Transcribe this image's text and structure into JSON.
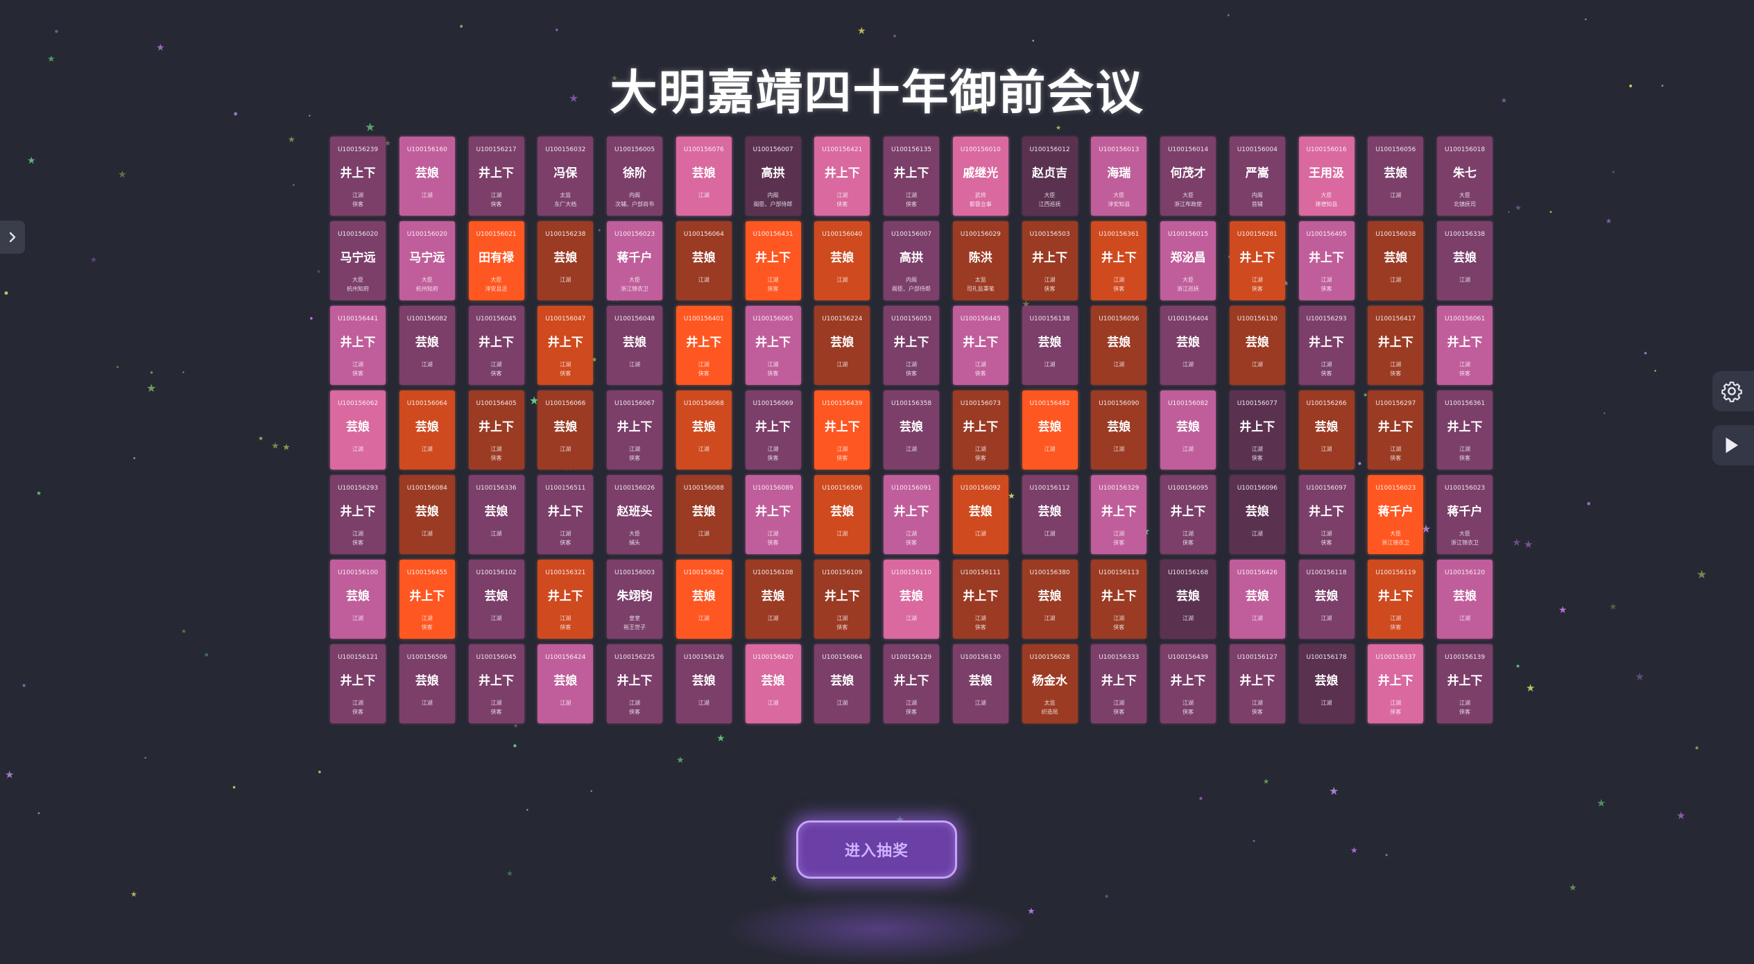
{
  "page": {
    "title": "大明嘉靖四十年御前会议",
    "enter_button_label": "进入抽奖",
    "left_tab_icon": "chevron-right-icon",
    "right_buttons": [
      {
        "icon": "gear-icon"
      },
      {
        "icon": "play-icon"
      }
    ]
  },
  "colors": {
    "background": "#262833",
    "card_palette": [
      "#c05e9b",
      "#7b3f6a",
      "#cf4a1f",
      "#9b3b24",
      "#ff5721",
      "#5a3250",
      "#d9699f"
    ],
    "button_border": "#c6a2ff",
    "button_fill": "#6a3fa6",
    "button_text": "#cfb3ff"
  },
  "cards": [
    {
      "id": "U100156239",
      "name": "井上下",
      "line1": "江湖",
      "line2": "侠客",
      "color": 1
    },
    {
      "id": "U100156160",
      "name": "芸娘",
      "line1": "江湖",
      "line2": "",
      "color": 0
    },
    {
      "id": "U100156217",
      "name": "井上下",
      "line1": "江湖",
      "line2": "侠客",
      "color": 1
    },
    {
      "id": "U100156032",
      "name": "冯保",
      "line1": "太监",
      "line2": "东厂大档",
      "color": 1
    },
    {
      "id": "U100156005",
      "name": "徐阶",
      "line1": "内阁",
      "line2": "次辅、户部尚书",
      "color": 1
    },
    {
      "id": "U100156076",
      "name": "芸娘",
      "line1": "江湖",
      "line2": "",
      "color": 6
    },
    {
      "id": "U100156007",
      "name": "高拱",
      "line1": "内阁",
      "line2": "阁臣、户部侍郎",
      "color": 5
    },
    {
      "id": "U100156421",
      "name": "井上下",
      "line1": "江湖",
      "line2": "侠客",
      "color": 6
    },
    {
      "id": "U100156135",
      "name": "井上下",
      "line1": "江湖",
      "line2": "侠客",
      "color": 1
    },
    {
      "id": "U100156010",
      "name": "戚继光",
      "line1": "武将",
      "line2": "都督佥事",
      "color": 6
    },
    {
      "id": "U100156012",
      "name": "赵贞吉",
      "line1": "大臣",
      "line2": "江西巡抚",
      "color": 5
    },
    {
      "id": "U100156013",
      "name": "海瑞",
      "line1": "大臣",
      "line2": "淳安知县",
      "color": 0
    },
    {
      "id": "U100156014",
      "name": "何茂才",
      "line1": "大臣",
      "line2": "浙江布政使",
      "color": 1
    },
    {
      "id": "U100156004",
      "name": "严嵩",
      "line1": "内阁",
      "line2": "首辅",
      "color": 1
    },
    {
      "id": "U100156016",
      "name": "王用汲",
      "line1": "大臣",
      "line2": "建德知县",
      "color": 6
    },
    {
      "id": "U100156056",
      "name": "芸娘",
      "line1": "江湖",
      "line2": "",
      "color": 1
    },
    {
      "id": "U100156018",
      "name": "朱七",
      "line1": "大臣",
      "line2": "北镇抚司",
      "color": 1
    },
    {
      "id": "U100156020",
      "name": "马宁远",
      "line1": "大臣",
      "line2": "杭州知府",
      "color": 1
    },
    {
      "id": "U100156020",
      "name": "马宁远",
      "line1": "大臣",
      "line2": "杭州知府",
      "color": 0
    },
    {
      "id": "U100156021",
      "name": "田有禄",
      "line1": "大臣",
      "line2": "淳安县丞",
      "color": 4
    },
    {
      "id": "U100156238",
      "name": "芸娘",
      "line1": "江湖",
      "line2": "",
      "color": 3
    },
    {
      "id": "U100156023",
      "name": "蒋千户",
      "line1": "大臣",
      "line2": "浙江锦衣卫",
      "color": 0
    },
    {
      "id": "U100156064",
      "name": "芸娘",
      "line1": "江湖",
      "line2": "",
      "color": 3
    },
    {
      "id": "U100156431",
      "name": "井上下",
      "line1": "江湖",
      "line2": "侠客",
      "color": 4
    },
    {
      "id": "U100156040",
      "name": "芸娘",
      "line1": "江湖",
      "line2": "",
      "color": 2
    },
    {
      "id": "U100156007",
      "name": "高拱",
      "line1": "内阁",
      "line2": "阁臣、户部侍郎",
      "color": 1
    },
    {
      "id": "U100156029",
      "name": "陈洪",
      "line1": "太监",
      "line2": "司礼监秉笔",
      "color": 3
    },
    {
      "id": "U100156503",
      "name": "井上下",
      "line1": "江湖",
      "line2": "侠客",
      "color": 3
    },
    {
      "id": "U100156361",
      "name": "井上下",
      "line1": "江湖",
      "line2": "侠客",
      "color": 2
    },
    {
      "id": "U100156015",
      "name": "郑泌昌",
      "line1": "大臣",
      "line2": "浙江巡抚",
      "color": 0
    },
    {
      "id": "U100156281",
      "name": "井上下",
      "line1": "江湖",
      "line2": "侠客",
      "color": 2
    },
    {
      "id": "U100156405",
      "name": "井上下",
      "line1": "江湖",
      "line2": "侠客",
      "color": 0
    },
    {
      "id": "U100156038",
      "name": "芸娘",
      "line1": "江湖",
      "line2": "",
      "color": 3
    },
    {
      "id": "U100156338",
      "name": "芸娘",
      "line1": "江湖",
      "line2": "",
      "color": 1
    },
    {
      "id": "U100156441",
      "name": "井上下",
      "line1": "江湖",
      "line2": "侠客",
      "color": 0
    },
    {
      "id": "U100156082",
      "name": "芸娘",
      "line1": "江湖",
      "line2": "",
      "color": 1
    },
    {
      "id": "U100156045",
      "name": "井上下",
      "line1": "江湖",
      "line2": "侠客",
      "color": 1
    },
    {
      "id": "U100156047",
      "name": "井上下",
      "line1": "江湖",
      "line2": "侠客",
      "color": 2
    },
    {
      "id": "U100156048",
      "name": "芸娘",
      "line1": "江湖",
      "line2": "",
      "color": 1
    },
    {
      "id": "U100156401",
      "name": "井上下",
      "line1": "江湖",
      "line2": "侠客",
      "color": 4
    },
    {
      "id": "U100156065",
      "name": "井上下",
      "line1": "江湖",
      "line2": "侠客",
      "color": 0
    },
    {
      "id": "U100156224",
      "name": "芸娘",
      "line1": "江湖",
      "line2": "",
      "color": 3
    },
    {
      "id": "U100156053",
      "name": "井上下",
      "line1": "江湖",
      "line2": "侠客",
      "color": 1
    },
    {
      "id": "U100156445",
      "name": "井上下",
      "line1": "江湖",
      "line2": "侠客",
      "color": 0
    },
    {
      "id": "U100156138",
      "name": "芸娘",
      "line1": "江湖",
      "line2": "",
      "color": 1
    },
    {
      "id": "U100156056",
      "name": "芸娘",
      "line1": "江湖",
      "line2": "",
      "color": 3
    },
    {
      "id": "U100156404",
      "name": "芸娘",
      "line1": "江湖",
      "line2": "",
      "color": 1
    },
    {
      "id": "U100156130",
      "name": "芸娘",
      "line1": "江湖",
      "line2": "",
      "color": 3
    },
    {
      "id": "U100156293",
      "name": "井上下",
      "line1": "江湖",
      "line2": "侠客",
      "color": 1
    },
    {
      "id": "U100156417",
      "name": "井上下",
      "line1": "江湖",
      "line2": "侠客",
      "color": 3
    },
    {
      "id": "U100156061",
      "name": "井上下",
      "line1": "江湖",
      "line2": "侠客",
      "color": 0
    },
    {
      "id": "U100156062",
      "name": "芸娘",
      "line1": "江湖",
      "line2": "",
      "color": 6
    },
    {
      "id": "U100156064",
      "name": "芸娘",
      "line1": "江湖",
      "line2": "",
      "color": 2
    },
    {
      "id": "U100156405",
      "name": "井上下",
      "line1": "江湖",
      "line2": "侠客",
      "color": 3
    },
    {
      "id": "U100156066",
      "name": "芸娘",
      "line1": "江湖",
      "line2": "",
      "color": 3
    },
    {
      "id": "U100156067",
      "name": "井上下",
      "line1": "江湖",
      "line2": "侠客",
      "color": 1
    },
    {
      "id": "U100156068",
      "name": "芸娘",
      "line1": "江湖",
      "line2": "",
      "color": 2
    },
    {
      "id": "U100156069",
      "name": "井上下",
      "line1": "江湖",
      "line2": "侠客",
      "color": 1
    },
    {
      "id": "U100156439",
      "name": "井上下",
      "line1": "江湖",
      "line2": "侠客",
      "color": 4
    },
    {
      "id": "U100156358",
      "name": "芸娘",
      "line1": "江湖",
      "line2": "",
      "color": 1
    },
    {
      "id": "U100156073",
      "name": "井上下",
      "line1": "江湖",
      "line2": "侠客",
      "color": 3
    },
    {
      "id": "U100156482",
      "name": "芸娘",
      "line1": "江湖",
      "line2": "",
      "color": 4
    },
    {
      "id": "U100156090",
      "name": "芸娘",
      "line1": "江湖",
      "line2": "",
      "color": 3
    },
    {
      "id": "U100156082",
      "name": "芸娘",
      "line1": "江湖",
      "line2": "",
      "color": 0
    },
    {
      "id": "U100156077",
      "name": "井上下",
      "line1": "江湖",
      "line2": "侠客",
      "color": 5
    },
    {
      "id": "U100156266",
      "name": "芸娘",
      "line1": "江湖",
      "line2": "",
      "color": 3
    },
    {
      "id": "U100156297",
      "name": "井上下",
      "line1": "江湖",
      "line2": "侠客",
      "color": 3
    },
    {
      "id": "U100156361",
      "name": "井上下",
      "line1": "江湖",
      "line2": "侠客",
      "color": 1
    },
    {
      "id": "U100156293",
      "name": "井上下",
      "line1": "江湖",
      "line2": "侠客",
      "color": 1
    },
    {
      "id": "U100156084",
      "name": "芸娘",
      "line1": "江湖",
      "line2": "",
      "color": 3
    },
    {
      "id": "U100156336",
      "name": "芸娘",
      "line1": "江湖",
      "line2": "",
      "color": 1
    },
    {
      "id": "U100156511",
      "name": "井上下",
      "line1": "江湖",
      "line2": "侠客",
      "color": 1
    },
    {
      "id": "U100156026",
      "name": "赵班头",
      "line1": "大臣",
      "line2": "捕头",
      "color": 1
    },
    {
      "id": "U100156088",
      "name": "芸娘",
      "line1": "江湖",
      "line2": "",
      "color": 3
    },
    {
      "id": "U100156089",
      "name": "井上下",
      "line1": "江湖",
      "line2": "侠客",
      "color": 0
    },
    {
      "id": "U100156506",
      "name": "芸娘",
      "line1": "江湖",
      "line2": "",
      "color": 2
    },
    {
      "id": "U100156091",
      "name": "井上下",
      "line1": "江湖",
      "line2": "侠客",
      "color": 0
    },
    {
      "id": "U100156092",
      "name": "芸娘",
      "line1": "江湖",
      "line2": "",
      "color": 2
    },
    {
      "id": "U100156112",
      "name": "芸娘",
      "line1": "江湖",
      "line2": "",
      "color": 1
    },
    {
      "id": "U100156329",
      "name": "井上下",
      "line1": "江湖",
      "line2": "侠客",
      "color": 0
    },
    {
      "id": "U100156095",
      "name": "井上下",
      "line1": "江湖",
      "line2": "侠客",
      "color": 1
    },
    {
      "id": "U100156096",
      "name": "芸娘",
      "line1": "江湖",
      "line2": "",
      "color": 5
    },
    {
      "id": "U100156097",
      "name": "井上下",
      "line1": "江湖",
      "line2": "侠客",
      "color": 1
    },
    {
      "id": "U100156023",
      "name": "蒋千户",
      "line1": "大臣",
      "line2": "浙江锦衣卫",
      "color": 4
    },
    {
      "id": "U100156023",
      "name": "蒋千户",
      "line1": "大臣",
      "line2": "浙江锦衣卫",
      "color": 1
    },
    {
      "id": "U100156100",
      "name": "芸娘",
      "line1": "江湖",
      "line2": "",
      "color": 0
    },
    {
      "id": "U100156455",
      "name": "井上下",
      "line1": "江湖",
      "line2": "侠客",
      "color": 4
    },
    {
      "id": "U100156102",
      "name": "芸娘",
      "line1": "江湖",
      "line2": "",
      "color": 1
    },
    {
      "id": "U100156321",
      "name": "井上下",
      "line1": "江湖",
      "line2": "侠客",
      "color": 2
    },
    {
      "id": "U100156003",
      "name": "朱翊钧",
      "line1": "皇室",
      "line2": "裕王世子",
      "color": 1
    },
    {
      "id": "U100156382",
      "name": "芸娘",
      "line1": "江湖",
      "line2": "",
      "color": 4
    },
    {
      "id": "U100156108",
      "name": "芸娘",
      "line1": "江湖",
      "line2": "",
      "color": 3
    },
    {
      "id": "U100156109",
      "name": "井上下",
      "line1": "江湖",
      "line2": "侠客",
      "color": 3
    },
    {
      "id": "U100156110",
      "name": "芸娘",
      "line1": "江湖",
      "line2": "",
      "color": 6
    },
    {
      "id": "U100156111",
      "name": "井上下",
      "line1": "江湖",
      "line2": "侠客",
      "color": 3
    },
    {
      "id": "U100156380",
      "name": "芸娘",
      "line1": "江湖",
      "line2": "",
      "color": 3
    },
    {
      "id": "U100156113",
      "name": "井上下",
      "line1": "江湖",
      "line2": "侠客",
      "color": 3
    },
    {
      "id": "U100156168",
      "name": "芸娘",
      "line1": "江湖",
      "line2": "",
      "color": 5
    },
    {
      "id": "U100156426",
      "name": "芸娘",
      "line1": "江湖",
      "line2": "",
      "color": 0
    },
    {
      "id": "U100156118",
      "name": "芸娘",
      "line1": "江湖",
      "line2": "",
      "color": 1
    },
    {
      "id": "U100156119",
      "name": "井上下",
      "line1": "江湖",
      "line2": "侠客",
      "color": 2
    },
    {
      "id": "U100156120",
      "name": "芸娘",
      "line1": "江湖",
      "line2": "",
      "color": 0
    },
    {
      "id": "U100156121",
      "name": "井上下",
      "line1": "江湖",
      "line2": "侠客",
      "color": 1
    },
    {
      "id": "U100156506",
      "name": "芸娘",
      "line1": "江湖",
      "line2": "",
      "color": 1
    },
    {
      "id": "U100156045",
      "name": "井上下",
      "line1": "江湖",
      "line2": "侠客",
      "color": 1
    },
    {
      "id": "U100156424",
      "name": "芸娘",
      "line1": "江湖",
      "line2": "",
      "color": 0
    },
    {
      "id": "U100156225",
      "name": "井上下",
      "line1": "江湖",
      "line2": "侠客",
      "color": 1
    },
    {
      "id": "U100156126",
      "name": "芸娘",
      "line1": "江湖",
      "line2": "",
      "color": 1
    },
    {
      "id": "U100156420",
      "name": "芸娘",
      "line1": "江湖",
      "line2": "",
      "color": 6
    },
    {
      "id": "U100156064",
      "name": "芸娘",
      "line1": "江湖",
      "line2": "",
      "color": 1
    },
    {
      "id": "U100156129",
      "name": "井上下",
      "line1": "江湖",
      "line2": "侠客",
      "color": 1
    },
    {
      "id": "U100156130",
      "name": "芸娘",
      "line1": "江湖",
      "line2": "",
      "color": 1
    },
    {
      "id": "U100156028",
      "name": "杨金水",
      "line1": "太监",
      "line2": "织造局",
      "color": 3
    },
    {
      "id": "U100156333",
      "name": "井上下",
      "line1": "江湖",
      "line2": "侠客",
      "color": 1
    },
    {
      "id": "U100156439",
      "name": "井上下",
      "line1": "江湖",
      "line2": "侠客",
      "color": 1
    },
    {
      "id": "U100156127",
      "name": "井上下",
      "line1": "江湖",
      "line2": "侠客",
      "color": 1
    },
    {
      "id": "U100156178",
      "name": "芸娘",
      "line1": "江湖",
      "line2": "",
      "color": 5
    },
    {
      "id": "U100156337",
      "name": "井上下",
      "line1": "江湖",
      "line2": "侠客",
      "color": 6
    },
    {
      "id": "U100156139",
      "name": "井上下",
      "line1": "江湖",
      "line2": "侠客",
      "color": 1
    }
  ]
}
